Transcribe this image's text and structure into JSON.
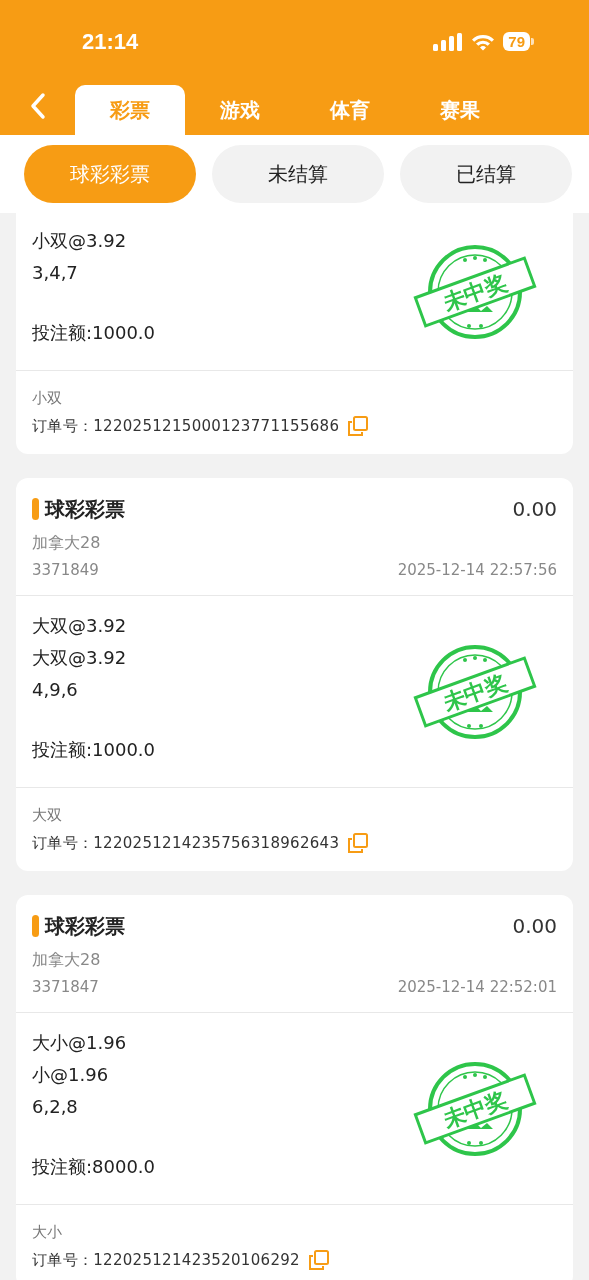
{
  "status_bar": {
    "time": "21:14",
    "battery": "79"
  },
  "nav": {
    "tabs": [
      {
        "label": "彩票",
        "selected": true
      },
      {
        "label": "游戏",
        "selected": false
      },
      {
        "label": "体育",
        "selected": false
      },
      {
        "label": "赛果",
        "selected": false
      }
    ]
  },
  "filters": [
    {
      "label": "球彩彩票",
      "selected": true
    },
    {
      "label": "未结算",
      "selected": false
    },
    {
      "label": "已结算",
      "selected": false
    }
  ],
  "bets": [
    {
      "selections": [
        "小双@3.92"
      ],
      "numbers": "3,4,7",
      "stake": "投注额:1000.0",
      "stamp": "未中奖",
      "play_type": "小双",
      "order_label": "订单号：",
      "order_no": "1220251215000123771155686"
    },
    {
      "title": "球彩彩票",
      "amount": "0.00",
      "lottery": "加拿大28",
      "issue": "3371849",
      "time": "2025-12-14 22:57:56",
      "selections": [
        "大双@3.92",
        "大双@3.92"
      ],
      "numbers": "4,9,6",
      "stake": "投注额:1000.0",
      "stamp": "未中奖",
      "play_type": "大双",
      "order_label": "订单号：",
      "order_no": "1220251214235756318962643"
    },
    {
      "title": "球彩彩票",
      "amount": "0.00",
      "lottery": "加拿大28",
      "issue": "3371847",
      "time": "2025-12-14 22:52:01",
      "selections": [
        "大小@1.96",
        "小@1.96"
      ],
      "numbers": "6,2,8",
      "stake": "投注额:8000.0",
      "stamp": "未中奖",
      "play_type": "大小",
      "order_label": "订单号：",
      "order_no": "122025121423520106292"
    }
  ]
}
